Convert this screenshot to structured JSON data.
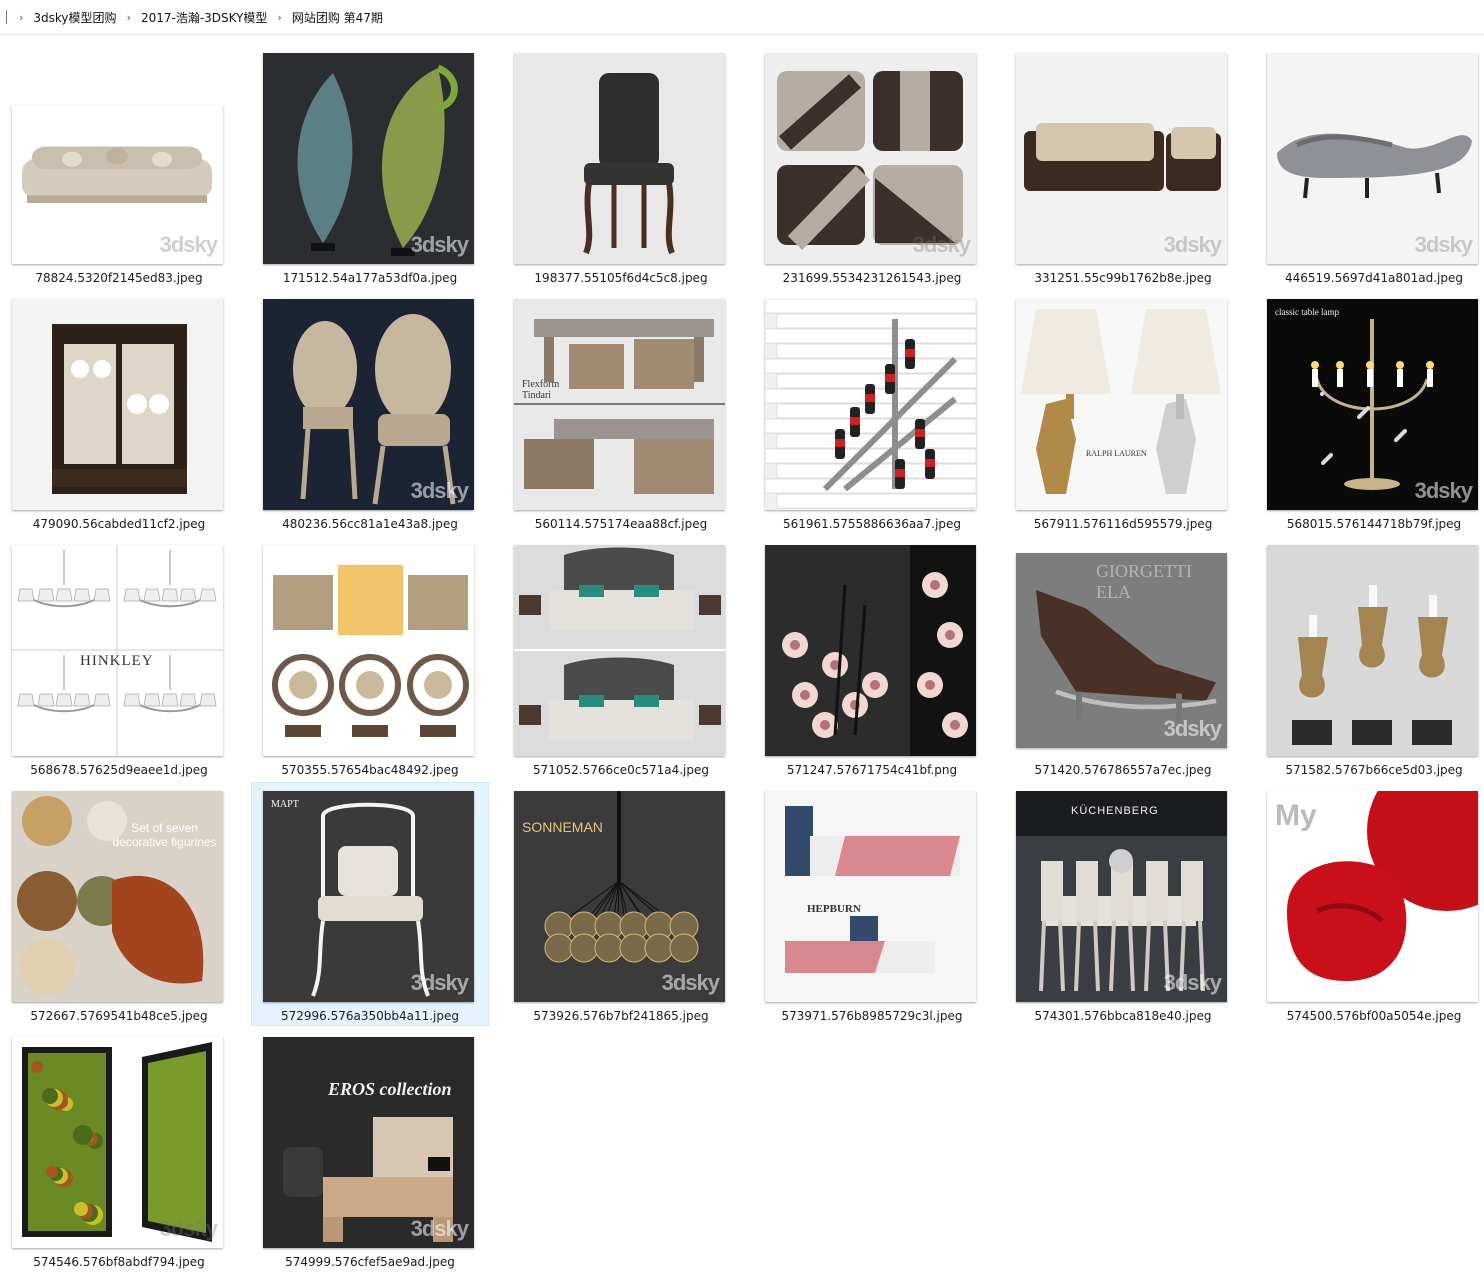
{
  "breadcrumb": {
    "items": [
      "3dsky模型团购",
      "2017-浩瀚-3DSKY模型",
      "网站团购 第47期"
    ]
  },
  "watermark": "3dsky",
  "files": [
    {
      "name": "78824.5320f2145ed83.jpeg",
      "art": "sofa-classic",
      "bg": "#ffffff"
    },
    {
      "name": "171512.54a177a53df0a.jpeg",
      "art": "leaf-sculpture",
      "bg": "#2b2d30"
    },
    {
      "name": "198377.55105f6d4c5c8.jpeg",
      "art": "leather-chair",
      "bg": "#e8e8e8"
    },
    {
      "name": "231699.5534231261543.jpeg",
      "art": "pillows",
      "bg": "#eeeeee"
    },
    {
      "name": "331251.55c99b1762b8e.jpeg",
      "art": "sofa-set",
      "bg": "#f2f2f2"
    },
    {
      "name": "446519.5697d41a801ad.jpeg",
      "art": "chaise",
      "bg": "#f4f4f4"
    },
    {
      "name": "479090.56cabded11cf2.jpeg",
      "art": "cabinet",
      "bg": "#f3f3f3"
    },
    {
      "name": "480236.56cc81a1e43a8.jpeg",
      "art": "two-chairs",
      "bg": "#1c2433"
    },
    {
      "name": "560114.575174eaa88cf.jpeg",
      "art": "tables",
      "bg": "#e9e9e9",
      "overlay": "Flexform Tindari"
    },
    {
      "name": "561961.5755886636aa7.jpeg",
      "art": "wine-rack",
      "bg": "#f0f0f0"
    },
    {
      "name": "567911.576116d595579.jpeg",
      "art": "sconces",
      "bg": "#f7f7f7",
      "overlay": "RALPH LAUREN"
    },
    {
      "name": "568015.576144718b79f.jpeg",
      "art": "candelabra",
      "bg": "#0a0a0a",
      "overlay": "classic table lamp"
    },
    {
      "name": "568678.57625d9eaee1d.jpeg",
      "art": "chandeliers",
      "bg": "#ffffff",
      "overlay": "HINKLEY"
    },
    {
      "name": "570355.57654bac48492.jpeg",
      "art": "lamps",
      "bg": "#ffffff"
    },
    {
      "name": "571052.5766ce0c571a4.jpeg",
      "art": "beds",
      "bg": "#dcdcdc"
    },
    {
      "name": "571247.57671754c41bf.png",
      "art": "magnolia",
      "bg": "#2c2c2c"
    },
    {
      "name": "571420.576786557a7ec.jpeg",
      "art": "lounger",
      "bg": "#7d7d7d",
      "overlay": "GIORGETTI ELA"
    },
    {
      "name": "571582.5767b66ce5d03.jpeg",
      "art": "candlesticks",
      "bg": "#d8d8d8"
    },
    {
      "name": "572667.5769541b48ce5.jpeg",
      "art": "figurines",
      "bg": "#d9d2c9",
      "overlay": "Set of seven decorative figurines"
    },
    {
      "name": "572996.576a350bb4a11.jpeg",
      "art": "iron-chair",
      "bg": "#3a3a3a",
      "overlay": "МАРТ",
      "selected": true
    },
    {
      "name": "573926.576b7bf241865.jpeg",
      "art": "pendant",
      "bg": "#3b3b3b",
      "overlay": "SONNEMAN"
    },
    {
      "name": "573971.576b8985729c3l.jpeg",
      "art": "hepburn",
      "bg": "#f6f6f6",
      "overlay": "HEPBURN"
    },
    {
      "name": "574301.576bbca818e40.jpeg",
      "art": "dining",
      "bg": "#3a3d42",
      "overlay": "KÜCHENBERG"
    },
    {
      "name": "574500.576bf00a5054e.jpeg",
      "art": "red-chair",
      "bg": "#ffffff",
      "overlay": "My"
    },
    {
      "name": "574546.576bf8abdf794.jpeg",
      "art": "moss",
      "bg": "#ffffff"
    },
    {
      "name": "574999.576cfef5ae9ad.jpeg",
      "art": "office",
      "bg": "#2a2a2a",
      "overlay": "EROS collection"
    }
  ]
}
